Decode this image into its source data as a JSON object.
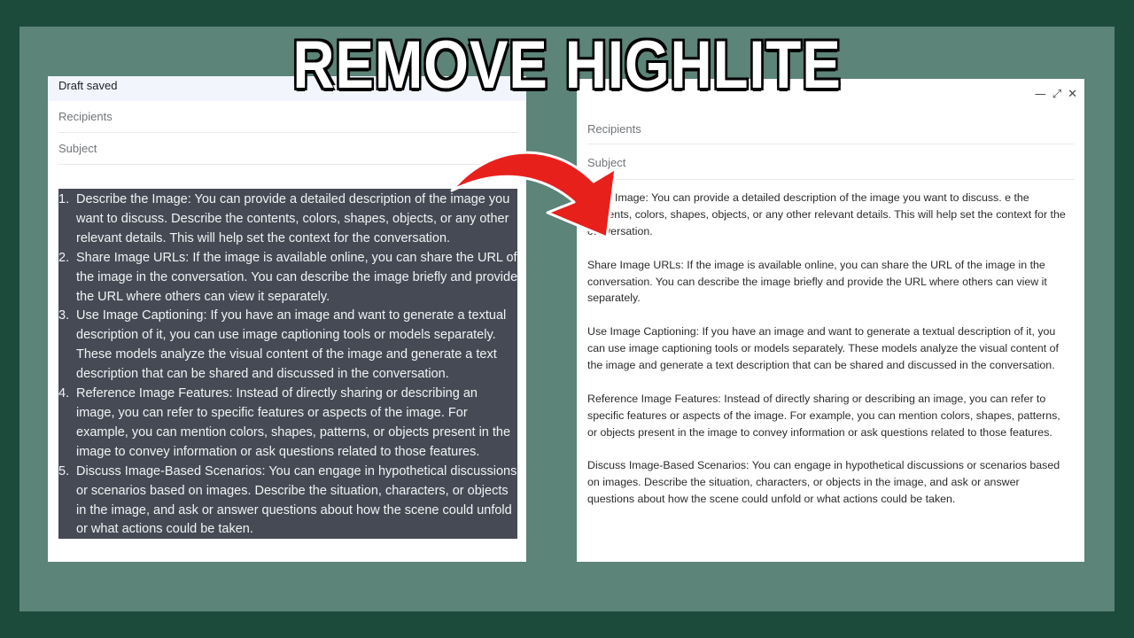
{
  "title": "REMOVE HIGHLITE",
  "colors": {
    "highlight": "#464a55",
    "arrow": "#e8201c",
    "background": "#1c4a3b"
  },
  "left_compose": {
    "status": "Draft saved",
    "recipients_placeholder": "Recipients",
    "subject_placeholder": "Subject",
    "items": [
      {
        "num": "1.",
        "text": "Describe the Image: You can provide a detailed description of the image you want to discuss. Describe the contents, colors, shapes, objects, or any other relevant details. This will help set the context for the conversation."
      },
      {
        "num": "2.",
        "text": "Share Image URLs: If the image is available online, you can share the URL of the image in the conversation. You can describe the image briefly and provide the URL where others can view it separately."
      },
      {
        "num": "3.",
        "text": "Use Image Captioning: If you have an image and want to generate a textual description of it, you can use image captioning tools or models separately. These models analyze the visual content of the image and generate a text description that can be shared and discussed in the conversation."
      },
      {
        "num": "4.",
        "text": "Reference Image Features: Instead of directly sharing or describing an image, you can refer to specific features or aspects of the image. For example, you can mention colors, shapes, patterns, or objects present in the image to convey information or ask questions related to those features."
      },
      {
        "num": "5.",
        "text": "Discuss Image-Based Scenarios: You can engage in hypothetical discussions or scenarios based on images. Describe the situation, characters, or objects in the image, and ask or answer questions about how the scene could unfold or what actions could be taken."
      }
    ]
  },
  "right_compose": {
    "window_icons": [
      "minimize-icon",
      "expand-icon",
      "close-icon"
    ],
    "recipients_placeholder": "Recipients",
    "subject_placeholder": "Subject",
    "paragraphs": [
      "e the Image: You can provide a detailed description of the image you want to discuss. e the contents, colors, shapes, objects, or any other relevant details. This will help set the context for the conversation.",
      "Share Image URLs: If the image is available online, you can share the URL of the image in the conversation. You can describe the image briefly and provide the URL where others can view it separately.",
      "Use Image Captioning: If you have an image and want to generate a textual description of it, you can use image captioning tools or models separately. These models analyze the visual content of the image and generate a text description that can be shared and discussed in the conversation.",
      "Reference Image Features: Instead of directly sharing or describing an image, you can refer to specific features or aspects of the image. For example, you can mention colors, shapes, patterns, or objects present in the image to convey information or ask questions related to those features.",
      "Discuss Image-Based Scenarios: You can engage in hypothetical discussions or scenarios based on images. Describe the situation, characters, or objects in the image, and ask or answer questions about how the scene could unfold or what actions could be taken."
    ]
  }
}
